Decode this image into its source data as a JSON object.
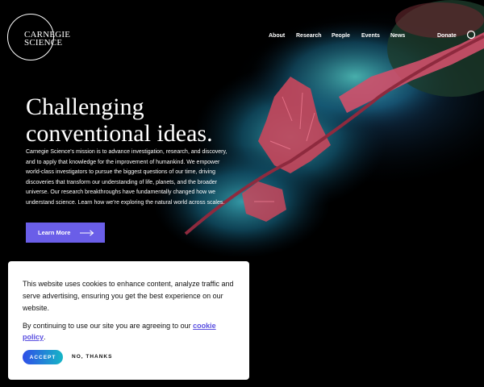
{
  "header": {
    "logo_line1": "CARNEGIE",
    "logo_line2": "SCIENCE",
    "nav": [
      "About",
      "Research",
      "People",
      "Events",
      "News",
      "Donate"
    ],
    "search_icon": "search-icon"
  },
  "hero": {
    "headline_line1": "Challenging",
    "headline_line2": "conventional ideas.",
    "mission": "Carnegie Science's mission is to advance investigation, research, and discovery, and to apply that knowledge for the improvement of humankind. We  empower world-class investigators to pursue the biggest questions of our time, driving discoveries that transform our understanding of life, planets, and the broader universe. Our research breakthroughs have fundamentally changed how we understand science. Learn how we’re exploring the natural world across scales.",
    "cta_label": "Learn More",
    "cta_icon": "arrow-right-icon",
    "cta_color": "#6a5ee8"
  },
  "cookie": {
    "message": "This website uses cookies to enhance content, analyze traffic and serve advertising, ensuring you get the best experience on our website.",
    "consent_prefix": "By continuing to use our site you are agreeing to our ",
    "policy_link": "cookie policy",
    "consent_suffix": ".",
    "accept_label": "ACCEPT",
    "decline_label": "NO, THANKS",
    "link_color": "#5a4fe0"
  }
}
